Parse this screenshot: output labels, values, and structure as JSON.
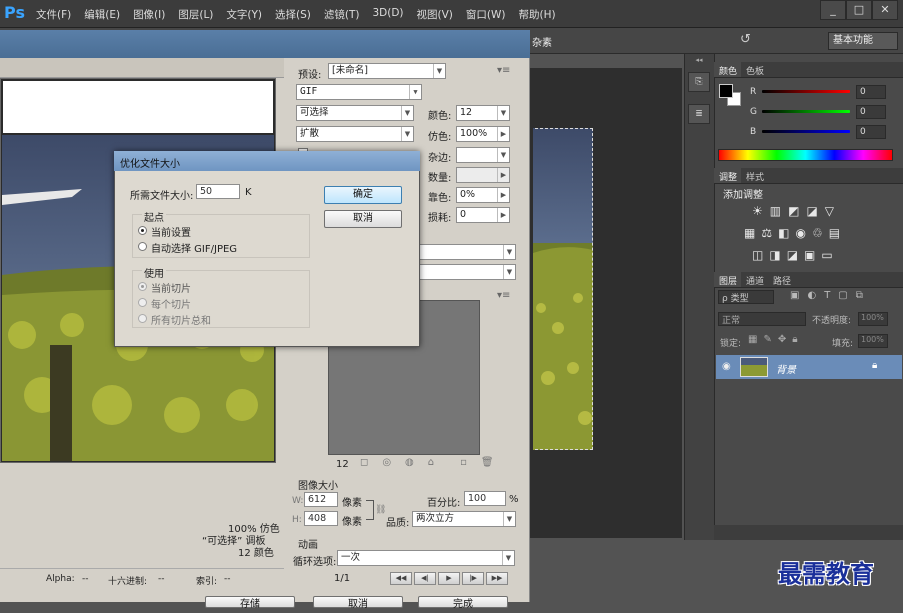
{
  "app": {
    "logo": "Ps",
    "menu": [
      "文件(F)",
      "编辑(E)",
      "图像(I)",
      "图层(L)",
      "文字(Y)",
      "选择(S)",
      "滤镜(T)",
      "3D(D)",
      "视图(V)",
      "窗口(W)",
      "帮助(H)"
    ],
    "window_controls": [
      "_",
      "□",
      "✕"
    ],
    "workspace": "基本功能",
    "doc_title_fragment": "杂素"
  },
  "save_for_web": {
    "preset_label": "预设:",
    "preset_value": "[未命名]",
    "format": "GIF",
    "reduction": "可选择",
    "dither_algo": "扩散",
    "colors_label": "颜色:",
    "colors_value": "12",
    "dither_label": "仿色:",
    "dither_value": "100%",
    "matte_label": "杂边:",
    "amount_label": "数量:",
    "web_snap_label": "靠色:",
    "web_snap_value": "0%",
    "lossy_label": "损耗:",
    "lossy_value": "0",
    "color_table_count": "12",
    "image_size_title": "图像大小",
    "width_label": "W:",
    "width_value": "612",
    "height_label": "H:",
    "height_value": "408",
    "unit": "像素",
    "percent_label": "百分比:",
    "percent_value": "100",
    "percent_unit": "%",
    "quality_label": "品质:",
    "quality_value": "两次立方",
    "animation_title": "动画",
    "loop_label": "循环选项:",
    "loop_value": "一次",
    "frame_counter": "1/1",
    "preview_info": [
      "100% 仿色",
      "“可选择” 调板",
      "12 颜色"
    ],
    "status": {
      "alpha_label": "Alpha:",
      "alpha_value": "--",
      "hex_label": "十六进制:",
      "hex_value": "--",
      "index_label": "索引:",
      "index_value": "--"
    },
    "bottom_buttons": [
      "存储",
      "取消",
      "完成"
    ]
  },
  "optimize_dialog": {
    "title": "优化文件大小",
    "target_label": "所需文件大小:",
    "target_value": "50",
    "target_unit": "K",
    "ok": "确定",
    "cancel": "取消",
    "start_group": "起点",
    "start_current": "当前设置",
    "start_auto": "自动选择 GIF/JPEG",
    "use_group": "使用",
    "use_current_slice": "当前切片",
    "use_each_slice": "每个切片",
    "use_total": "所有切片总和"
  },
  "right_panels": {
    "color_tabs": [
      "颜色",
      "色板"
    ],
    "color_channels": [
      {
        "label": "R",
        "value": "0",
        "color": "#d82020"
      },
      {
        "label": "G",
        "value": "0",
        "color": "#22b022"
      },
      {
        "label": "B",
        "value": "0",
        "color": "#2244d8"
      }
    ],
    "adjust_tabs": [
      "调整",
      "样式"
    ],
    "adjust_title": "添加调整",
    "layers_tabs": [
      "图层",
      "通道",
      "路径"
    ],
    "kind_label": "ρ 类型",
    "blend_mode": "正常",
    "opacity_label": "不透明度:",
    "opacity_value": "100%",
    "lock_label": "锁定:",
    "fill_label": "填充:",
    "fill_value": "100%",
    "layer_name": "背景"
  },
  "watermark": "最需教育"
}
